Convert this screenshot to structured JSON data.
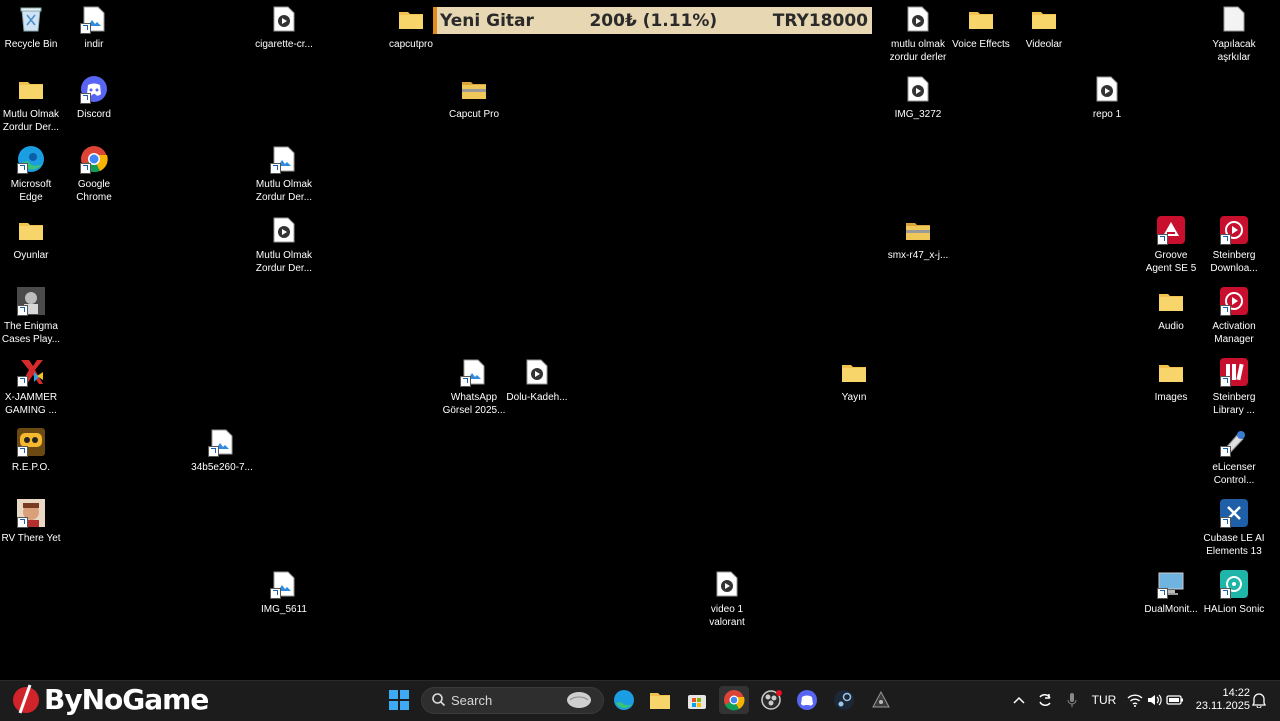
{
  "ticker": {
    "name": "Yeni Gitar",
    "amount": "200₺ (1.11%)",
    "target": "TRY18000"
  },
  "desktop": {
    "recycle_bin": "Recycle Bin",
    "indir": "indir",
    "cigarette": "cigarette-cr...",
    "capcutpro": "capcutpro",
    "mutlu_olmak_video_l1": "mutlu olmak",
    "mutlu_olmak_video_l2": "zordur derler",
    "voice_effects": "Voice Effects",
    "videolar": "Videolar",
    "yapilacak_l1": "Yapılacak",
    "yapilacak_l2": "aşrkılar",
    "mutlu_folder_l1": "Mutlu Olmak",
    "mutlu_folder_l2": "Zordur Der...",
    "discord": "Discord",
    "capcut_pro": "Capcut Pro",
    "img_3272": "IMG_3272",
    "repo1": "repo 1",
    "edge_l1": "Microsoft",
    "edge_l2": "Edge",
    "chrome_l1": "Google",
    "chrome_l2": "Chrome",
    "mutlu_img_l1": "Mutlu Olmak",
    "mutlu_img_l2": "Zordur Der...",
    "oyunlar": "Oyunlar",
    "mutlu_vid2_l1": "Mutlu Olmak",
    "mutlu_vid2_l2": "Zordur Der...",
    "smx": "smx-r47_x-j...",
    "groove_l1": "Groove",
    "groove_l2": "Agent SE 5",
    "steinberg_dl_l1": "Steinberg",
    "steinberg_dl_l2": "Downloa...",
    "enigma_l1": "The Enigma",
    "enigma_l2": "Cases Play...",
    "audio": "Audio",
    "activation_l1": "Activation",
    "activation_l2": "Manager",
    "xjammer_l1": "X-JAMMER",
    "xjammer_l2": "GAMING ...",
    "whatsapp_l1": "WhatsApp",
    "whatsapp_l2": "Görsel 2025...",
    "dolu": "Dolu-Kadeh...",
    "yayin": "Yayın",
    "images": "Images",
    "steinberg_lib_l1": "Steinberg",
    "steinberg_lib_l2": "Library ...",
    "repo_game": "R.E.P.O.",
    "hash_img": "34b5e260-7...",
    "elicenser_l1": "eLicenser",
    "elicenser_l2": "Control...",
    "rv": "RV There Yet",
    "cubase_l1": "Cubase LE AI",
    "cubase_l2": "Elements 13",
    "img_5611": "IMG_5611",
    "video1_l1": "video 1",
    "video1_l2": "valorant",
    "dualmonitor": "DualMonit...",
    "halion": "HALion Sonic"
  },
  "taskbar": {
    "brand": "ByNoGame",
    "search_placeholder": "Search",
    "lang": "TUR",
    "time": "14:22",
    "date": "23.11.2025"
  }
}
